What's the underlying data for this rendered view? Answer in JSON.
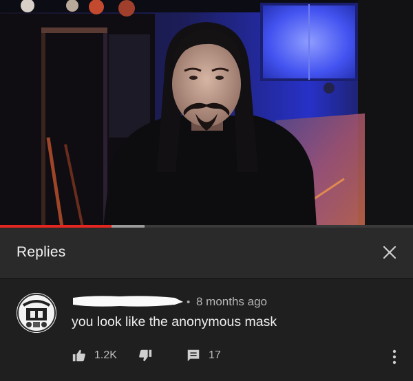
{
  "player": {
    "progress_played_fraction": 0.27,
    "progress_buffered_fraction": 0.08,
    "accent_color": "#e52620"
  },
  "replies_panel": {
    "title": "Replies",
    "close_icon": "close-icon"
  },
  "comment": {
    "author_name_redacted": true,
    "separator": "•",
    "timestamp": "8 months ago",
    "text": "you look like the anonymous mask",
    "likes": "1.2K",
    "replies_count": "17",
    "icons": {
      "like": "thumbs-up-icon",
      "dislike": "thumbs-down-icon",
      "reply": "comment-icon",
      "more": "more-vertical-icon"
    }
  }
}
